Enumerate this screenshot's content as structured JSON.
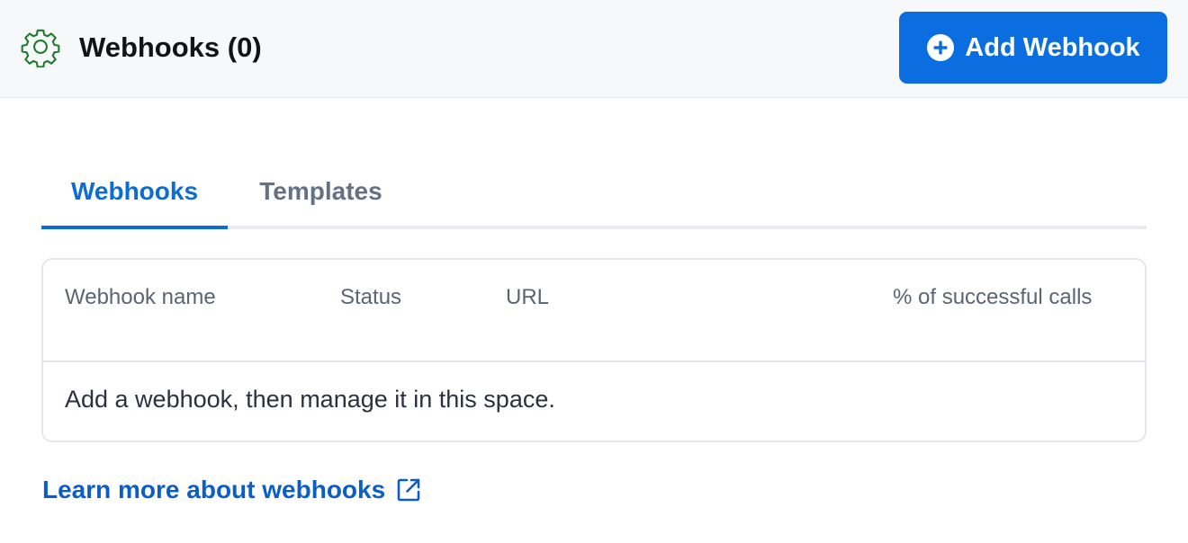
{
  "header": {
    "title": "Webhooks (0)",
    "icon": "gear-icon",
    "icon_color": "#1f7a2e",
    "add_button": {
      "label": "Add Webhook",
      "icon": "plus-circle-icon",
      "color": "#0b6ee0"
    }
  },
  "tabs": [
    {
      "label": "Webhooks",
      "active": true
    },
    {
      "label": "Templates",
      "active": false
    }
  ],
  "table": {
    "columns": [
      "Webhook name",
      "Status",
      "URL",
      "% of successful calls"
    ],
    "empty_message": "Add a webhook, then manage it in this space."
  },
  "learn_more": {
    "label": "Learn more about webhooks",
    "icon": "external-link-icon",
    "color": "#0b5fc4"
  }
}
